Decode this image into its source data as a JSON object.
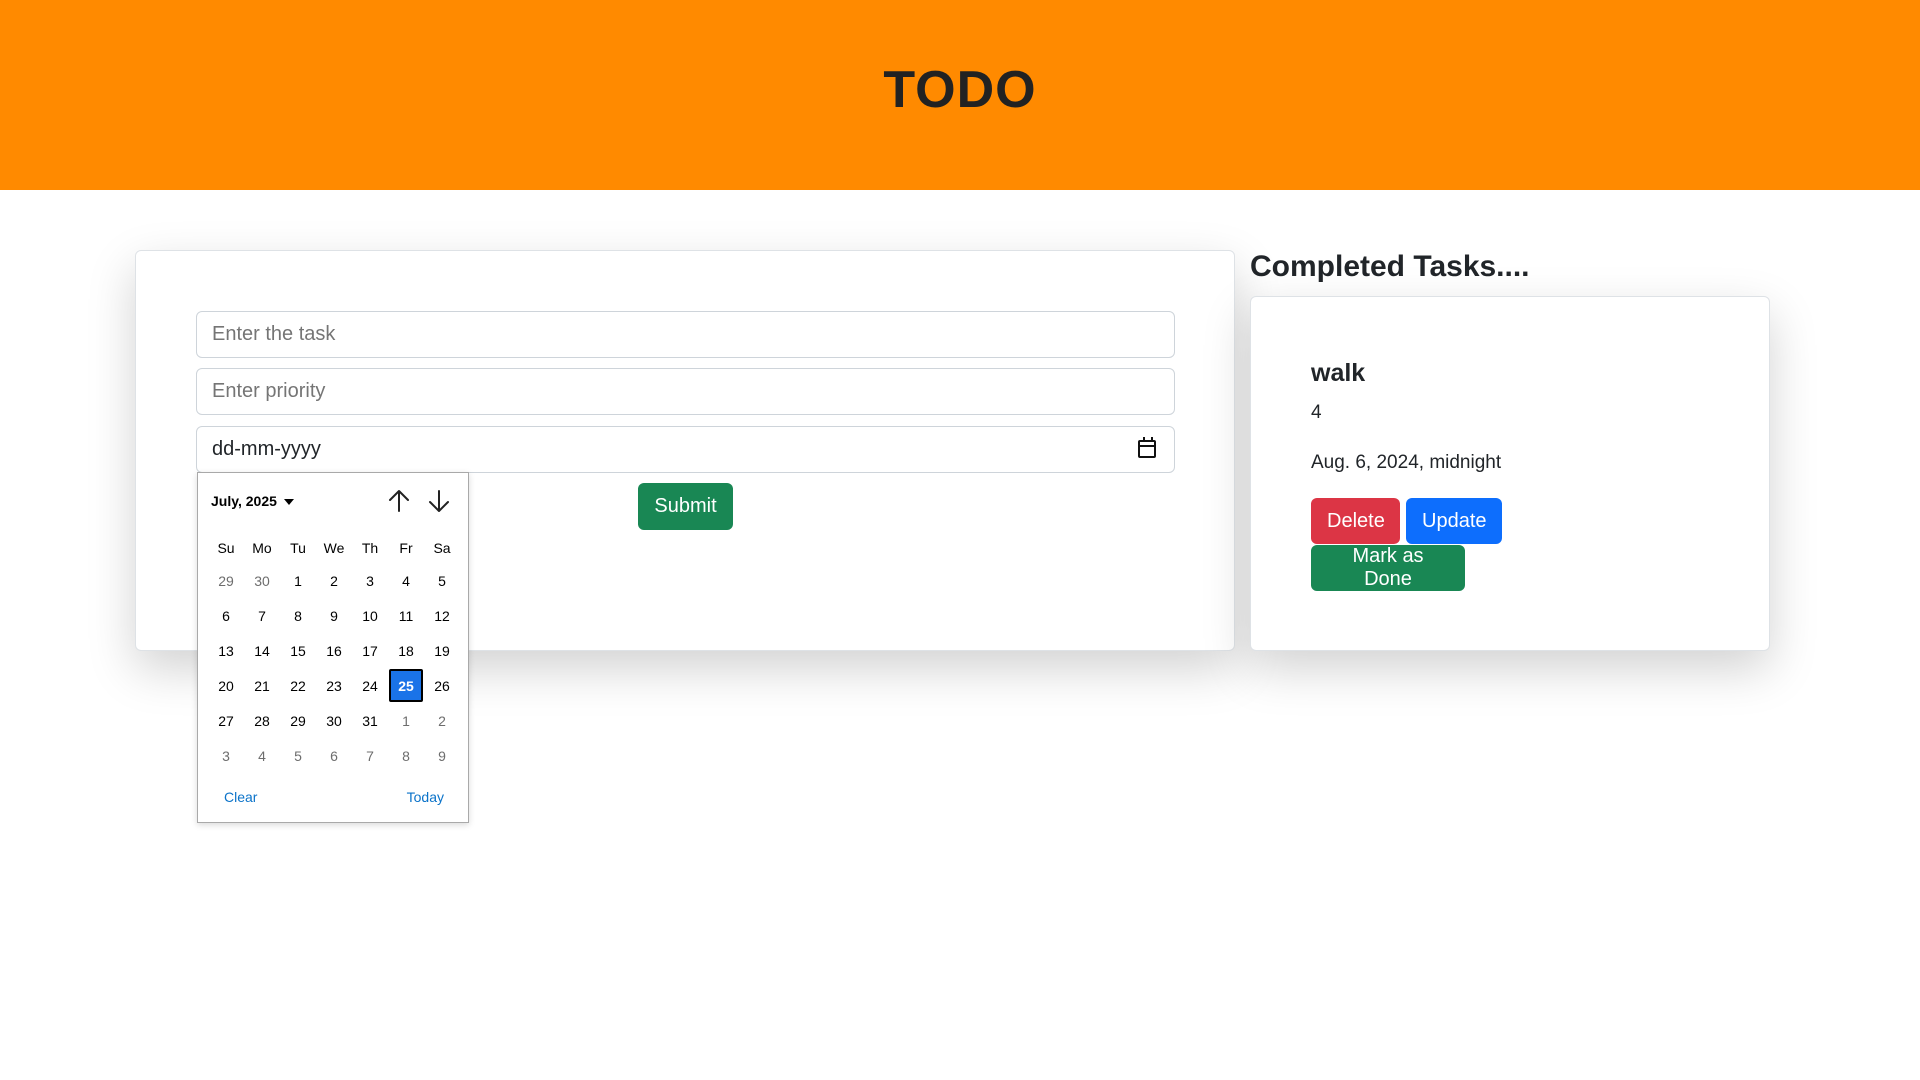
{
  "header": {
    "title": "TODO"
  },
  "form": {
    "task_placeholder": "Enter the task",
    "priority_placeholder": "Enter priority",
    "date_value": "dd-mm-yyyy",
    "submit_label": "Submit"
  },
  "completed": {
    "title": "Completed Tasks....",
    "task": {
      "name": "walk",
      "priority": "4",
      "date": "Aug. 6, 2024, midnight",
      "delete_label": "Delete",
      "update_label": "Update",
      "done_label": "Mark as Done"
    }
  },
  "datepicker": {
    "month_label": "July, 2025",
    "weekdays": [
      "Su",
      "Mo",
      "Tu",
      "We",
      "Th",
      "Fr",
      "Sa"
    ],
    "weeks": [
      [
        {
          "d": "29",
          "o": true
        },
        {
          "d": "30",
          "o": true
        },
        {
          "d": "1"
        },
        {
          "d": "2"
        },
        {
          "d": "3"
        },
        {
          "d": "4"
        },
        {
          "d": "5"
        }
      ],
      [
        {
          "d": "6"
        },
        {
          "d": "7"
        },
        {
          "d": "8"
        },
        {
          "d": "9"
        },
        {
          "d": "10"
        },
        {
          "d": "11"
        },
        {
          "d": "12"
        }
      ],
      [
        {
          "d": "13"
        },
        {
          "d": "14"
        },
        {
          "d": "15"
        },
        {
          "d": "16"
        },
        {
          "d": "17"
        },
        {
          "d": "18"
        },
        {
          "d": "19"
        }
      ],
      [
        {
          "d": "20"
        },
        {
          "d": "21"
        },
        {
          "d": "22"
        },
        {
          "d": "23"
        },
        {
          "d": "24"
        },
        {
          "d": "25",
          "s": true
        },
        {
          "d": "26"
        }
      ],
      [
        {
          "d": "27"
        },
        {
          "d": "28"
        },
        {
          "d": "29"
        },
        {
          "d": "30"
        },
        {
          "d": "31"
        },
        {
          "d": "1",
          "o": true
        },
        {
          "d": "2",
          "o": true
        }
      ],
      [
        {
          "d": "3",
          "o": true
        },
        {
          "d": "4",
          "o": true
        },
        {
          "d": "5",
          "o": true
        },
        {
          "d": "6",
          "o": true
        },
        {
          "d": "7",
          "o": true
        },
        {
          "d": "8",
          "o": true
        },
        {
          "d": "9",
          "o": true
        }
      ]
    ],
    "clear_label": "Clear",
    "today_label": "Today"
  },
  "colors": {
    "header_bg": "#ff8a00",
    "success": "#198754",
    "danger": "#dc3545",
    "primary": "#0d6efd",
    "selected_day": "#1a73e8"
  }
}
